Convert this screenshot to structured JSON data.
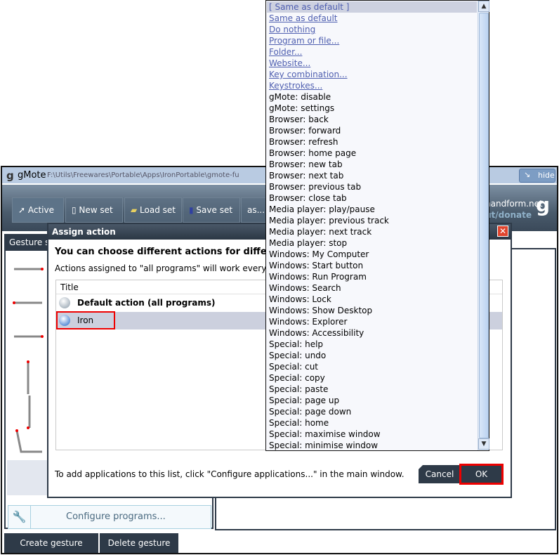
{
  "window": {
    "logo": "g",
    "title": "gMote",
    "path": "F:\\Utils\\Freewares\\Portable\\Apps\\IronPortable\\gmote-fu",
    "hide_label": "hide"
  },
  "toolbar": {
    "active": "Active",
    "new_set": "New set",
    "load_set": "Load set",
    "save_set": "Save set",
    "save_as": "as...",
    "brand_line1": "handform.net",
    "brand_line2": "ut/donate",
    "brand_logo": "g"
  },
  "left": {
    "tab": "Gesture s",
    "configure": "Configure programs...",
    "create": "Create gesture",
    "delete": "Delete gesture"
  },
  "dialog": {
    "title": "Assign action",
    "heading": "You can choose different actions for different",
    "subtext": "Actions assigned to \"all programs\" will work everywh",
    "column": "Title",
    "rows": [
      {
        "label": "Default action (all programs)",
        "bold": true
      },
      {
        "label": "Iron",
        "bold": false,
        "selected": true
      }
    ],
    "footer": "To add applications to this list, click \"Configure applications...\" in the main window.",
    "cancel": "Cancel",
    "ok": "OK"
  },
  "dropdown": {
    "selected": "[ Same as default ]",
    "links": [
      "Same as default",
      "Do nothing",
      "Program or file...",
      "Folder...",
      "Website...",
      "Key combination...",
      "Keystrokes..."
    ],
    "items": [
      "gMote: disable",
      "gMote: settings",
      "Browser: back",
      "Browser: forward",
      "Browser: refresh",
      "Browser: home page",
      "Browser: new tab",
      "Browser: next tab",
      "Browser: previous tab",
      "Browser: close tab",
      "Media player: play/pause",
      "Media player: previous track",
      "Media player: next track",
      "Media player: stop",
      "Windows: My Computer",
      "Windows: Start button",
      "Windows: Run Program",
      "Windows: Search",
      "Windows: Lock",
      "Windows: Show Desktop",
      "Windows: Explorer",
      "Windows: Accessibility",
      "Special: help",
      "Special: undo",
      "Special: cut",
      "Special: copy",
      "Special: paste",
      "Special: page up",
      "Special: page down",
      "Special: home",
      "Special: maximise window",
      "Special: minimise window"
    ]
  },
  "colors": {
    "highlight": "#e00000",
    "dark": "#2e3a48",
    "link": "#4f5fb0"
  }
}
